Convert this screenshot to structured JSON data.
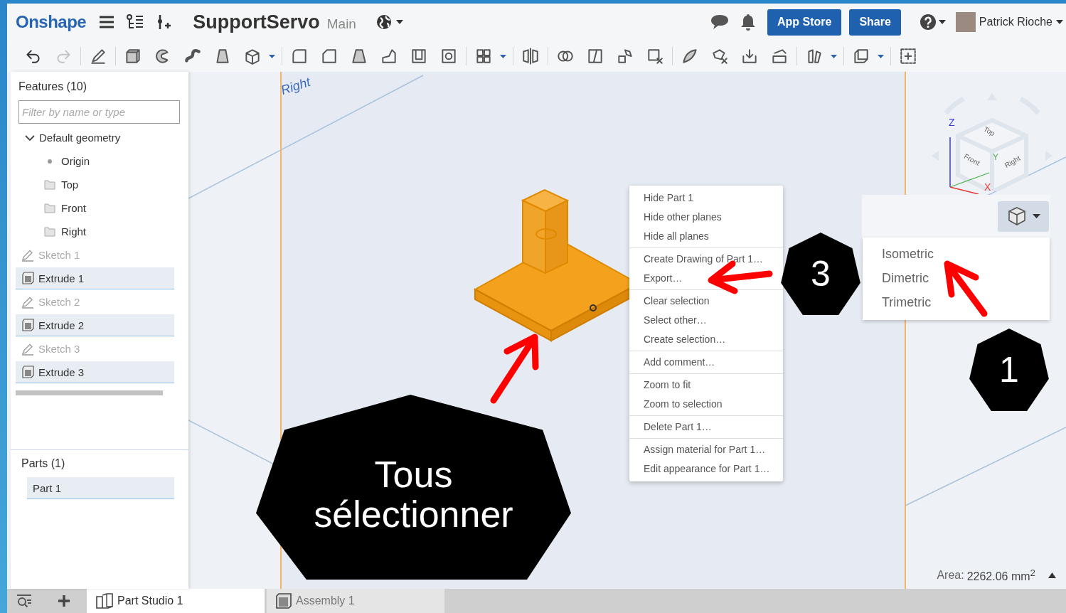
{
  "header": {
    "logo": "Onshape",
    "document_title": "SupportServo",
    "branch": "Main",
    "buttons": [
      "App Store",
      "Share"
    ],
    "user_name": "Patrick Rioche"
  },
  "features_panel": {
    "title": "Features (10)",
    "filter": {
      "placeholder": "Filter by name or type"
    },
    "tree": [
      {
        "label": "Default geometry",
        "kind": "group",
        "expanded": true,
        "selected": false,
        "hidden": false,
        "children": [
          {
            "label": "Origin",
            "kind": "point",
            "selected": false,
            "hidden": false
          },
          {
            "label": "Top",
            "kind": "plane",
            "selected": false,
            "hidden": false
          },
          {
            "label": "Front",
            "kind": "plane",
            "selected": false,
            "hidden": false
          },
          {
            "label": "Right",
            "kind": "plane",
            "selected": false,
            "hidden": false
          }
        ]
      },
      {
        "label": "Sketch 1",
        "kind": "sketch",
        "selected": false,
        "hidden": true
      },
      {
        "label": "Extrude 1",
        "kind": "extrude",
        "selected": true,
        "hidden": false
      },
      {
        "label": "Sketch 2",
        "kind": "sketch",
        "selected": false,
        "hidden": true
      },
      {
        "label": "Extrude 2",
        "kind": "extrude",
        "selected": true,
        "hidden": false
      },
      {
        "label": "Sketch 3",
        "kind": "sketch",
        "selected": false,
        "hidden": true
      },
      {
        "label": "Extrude 3",
        "kind": "extrude",
        "selected": true,
        "hidden": false
      }
    ]
  },
  "parts_panel": {
    "title": "Parts (1)",
    "items": [
      {
        "label": "Part 1",
        "selected": true
      }
    ]
  },
  "viewport": {
    "plane_label": "Right",
    "context_menu": {
      "groups": [
        [
          "Hide Part 1",
          "Hide other planes",
          "Hide all planes"
        ],
        [
          "Create Drawing of Part 1…",
          "Export…"
        ],
        [
          "Clear selection",
          "Select other…",
          "Create selection…"
        ],
        [
          "Add comment…"
        ],
        [
          "Zoom to fit",
          "Zoom to selection"
        ],
        [
          "Delete Part 1…"
        ],
        [
          "Assign material for Part 1…",
          "Edit appearance for Part 1…"
        ]
      ]
    },
    "view_cube": {
      "faces": [
        "Top",
        "Front",
        "Right"
      ],
      "axes": [
        "X",
        "Y",
        "Z"
      ]
    },
    "view_menu": {
      "items": [
        "Isometric",
        "Dimetric",
        "Trimetric"
      ]
    },
    "area": {
      "label": "Area:",
      "value": "2262.06 mm$^{2}$"
    }
  },
  "annotations": [
    {
      "kind": "badge",
      "text": "3"
    },
    {
      "kind": "badge",
      "text": "1"
    },
    {
      "kind": "callout",
      "text": "Tous sélectionner"
    }
  ],
  "tabs": [
    {
      "label": "Part Studio 1",
      "kind": "part_studio",
      "selected": true
    },
    {
      "label": "Assembly 1",
      "kind": "assembly",
      "selected": false
    }
  ]
}
